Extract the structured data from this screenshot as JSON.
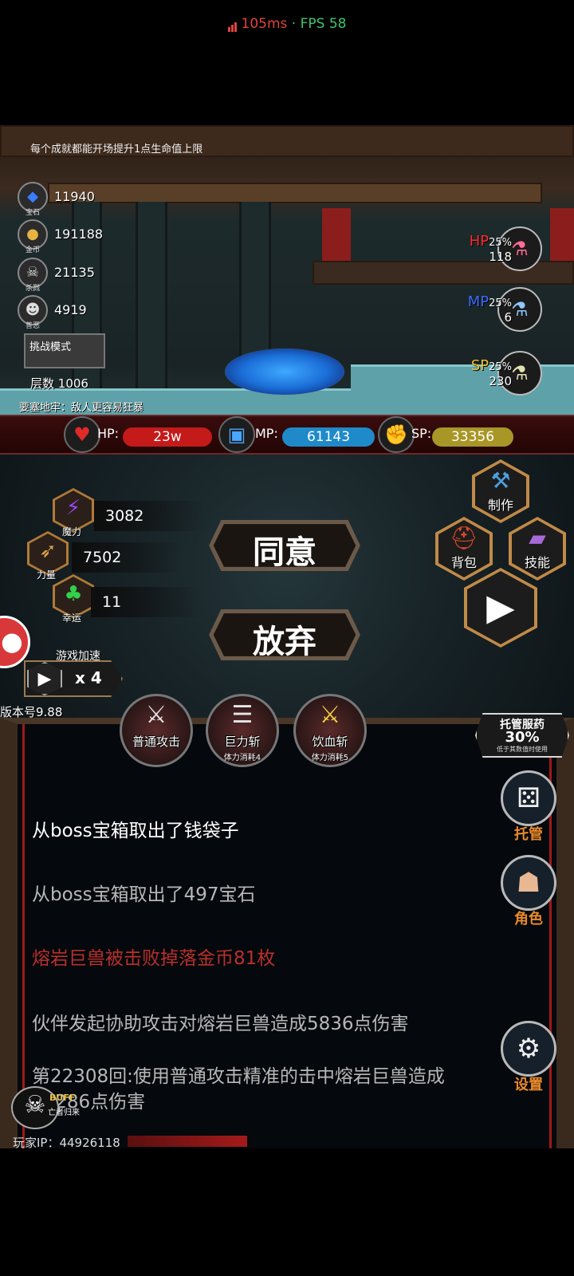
{
  "status": {
    "ping": "105ms",
    "sep": "·",
    "fps": "FPS 58",
    "ping_color": "#e0423f",
    "fps_color": "#3ec46d"
  },
  "scene": {
    "hint": "每个成就都能开场提升1点生命值上限",
    "resources": [
      {
        "icon": "gem-icon",
        "glyph": "◆",
        "label": "宝石",
        "value": "11940"
      },
      {
        "icon": "coin-icon",
        "glyph": "●",
        "label": "金币",
        "value": "191188"
      },
      {
        "icon": "skull-icon",
        "glyph": "☠",
        "label": "杀戮",
        "value": "21135"
      },
      {
        "icon": "mask-icon",
        "glyph": "☻",
        "label": "善恶",
        "value": "4919"
      }
    ],
    "challenge_mode": "挑战模式",
    "floor_label": "层数",
    "floor_value": "1006",
    "fortress_note": "要塞地牢：敌人更容易狂暴",
    "potions": [
      {
        "key": "HP",
        "pct": "25%",
        "count": "118",
        "color": "#ff2a2a",
        "icon": "hp-potion-icon"
      },
      {
        "key": "MP",
        "pct": "25%",
        "count": "6",
        "color": "#3a6dff",
        "icon": "mp-potion-icon"
      },
      {
        "key": "SP",
        "pct": "25%",
        "count": "230",
        "color": "#f2c432",
        "icon": "sp-potion-icon"
      }
    ]
  },
  "bars": {
    "hp": {
      "label": "HP:",
      "value": "23w",
      "color": "#c41a1a"
    },
    "mp": {
      "label": "MP:",
      "value": "61143",
      "color": "#1f8ac9"
    },
    "sp": {
      "label": "SP:",
      "value": "33356",
      "color": "#a89627"
    }
  },
  "attributes": [
    {
      "name": "魔力",
      "value": "3082",
      "icon": "magic-icon",
      "glyph": "⚡",
      "color": "#9b47ff"
    },
    {
      "name": "力量",
      "value": "7502",
      "icon": "strength-icon",
      "glyph": "➶",
      "color": "#d9a54a"
    },
    {
      "name": "幸运",
      "value": "11",
      "icon": "clover-icon",
      "glyph": "♣",
      "color": "#33d04a"
    }
  ],
  "actions": {
    "agree": "同意",
    "abandon": "放弃"
  },
  "menu": {
    "craft": "制作",
    "bag": "背包",
    "skills": "技能"
  },
  "speed": {
    "label": "游戏加速",
    "multiplier": "x 4"
  },
  "version": "版本号9.88",
  "skills": [
    {
      "name": "普通攻击",
      "cost": ""
    },
    {
      "name": "巨力斩",
      "cost": "体力消耗4"
    },
    {
      "name": "饮血斩",
      "cost": "体力消耗5"
    }
  ],
  "auto_potion": {
    "title": "托管服药",
    "pct": "30%",
    "sub": "低于其数值时使用"
  },
  "log": [
    {
      "text": "从boss宝箱取出了钱袋子",
      "color": "#ffffff"
    },
    {
      "text": "从boss宝箱取出了497宝石",
      "color": "#b8b8b8"
    },
    {
      "text": "熔岩巨兽被击败掉落金币81枚",
      "color": "#b8302c"
    },
    {
      "text": "伙伴发起协助攻击对熔岩巨兽造成5836点伤害",
      "color": "#b8b8b8"
    },
    {
      "text": "第22308回:使用普通攻击精准的击中熔岩巨兽造成73286点伤害",
      "color": "#b8b8b8"
    }
  ],
  "side_buttons": {
    "auto": "托管",
    "role": "角色",
    "settings": "设置"
  },
  "buff": {
    "label": "BUFF",
    "name": "亡者归来"
  },
  "player_ip": "玩家IP：44926118"
}
